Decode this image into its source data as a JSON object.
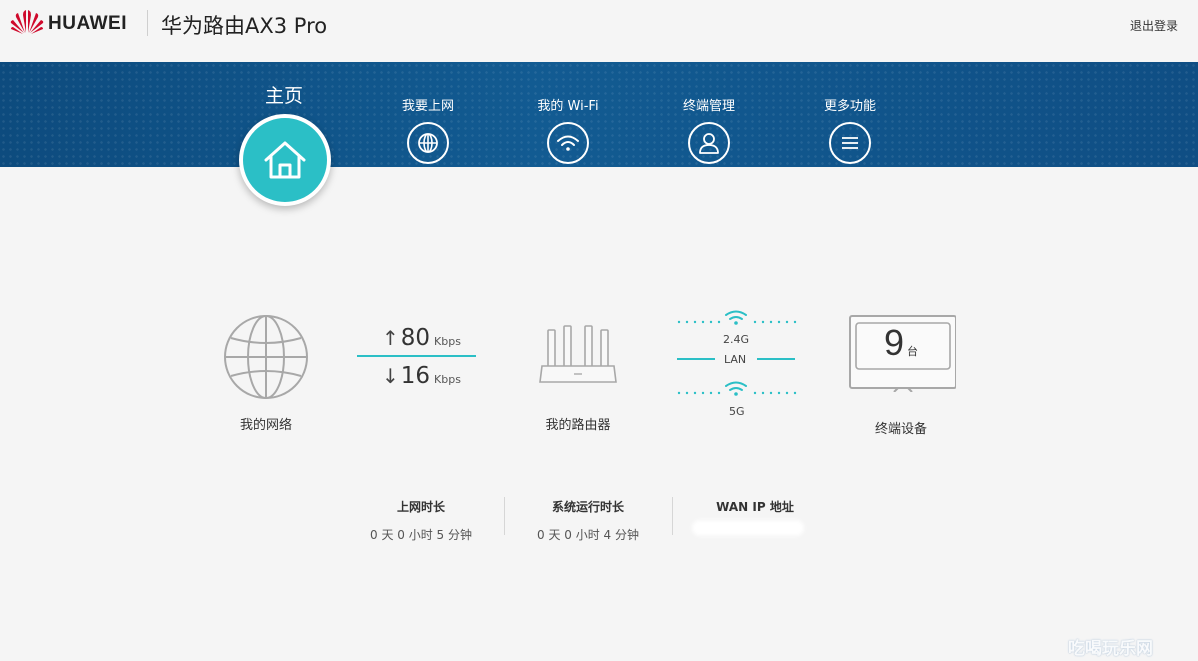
{
  "header": {
    "brand": "HUAWEI",
    "product": "华为路由AX3 Pro",
    "logout": "退出登录"
  },
  "nav": {
    "home": "主页",
    "items": [
      {
        "label": "我要上网",
        "icon": "globe-icon"
      },
      {
        "label": "我的 Wi-Fi",
        "icon": "wifi-icon"
      },
      {
        "label": "终端管理",
        "icon": "user-icon"
      },
      {
        "label": "更多功能",
        "icon": "menu-icon"
      }
    ]
  },
  "status": {
    "network_label": "我的网络",
    "upload_value": "80",
    "download_value": "16",
    "speed_unit": "Kbps",
    "router_label": "我的路由器",
    "band_24": "2.4G",
    "lan": "LAN",
    "band_5": "5G",
    "device_count": "9",
    "device_unit": "台",
    "devices_label": "终端设备"
  },
  "info": {
    "online_title": "上网时长",
    "online_value": "0 天 0 小时 5 分钟",
    "uptime_title": "系统运行时长",
    "uptime_value": "0 天 0 小时 4 分钟",
    "wan_title": "WAN IP 地址"
  },
  "watermark": "吃喝玩乐网",
  "colors": {
    "accent": "#2bbfc6",
    "nav_band": "#125b92",
    "brand_red": "#cf0a2c"
  }
}
